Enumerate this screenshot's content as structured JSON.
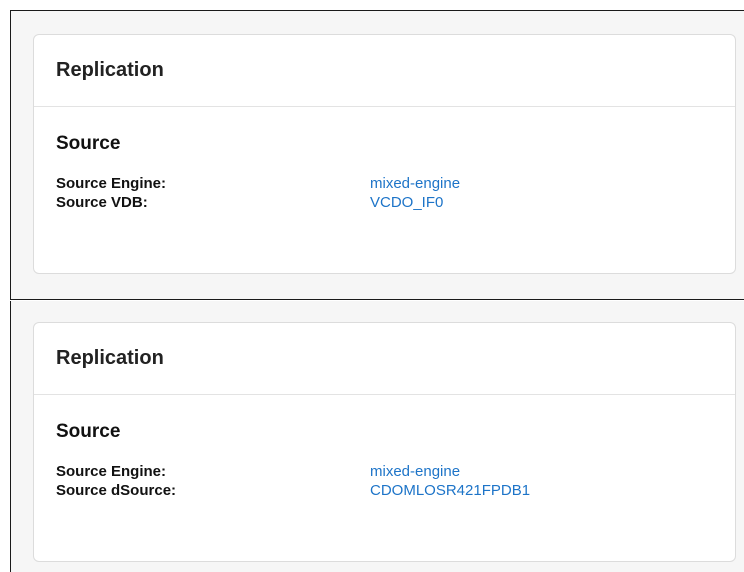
{
  "panels": [
    {
      "card_title": "Replication",
      "section_title": "Source",
      "fields": [
        {
          "label": "Source Engine:",
          "value": "mixed-engine"
        },
        {
          "label": "Source VDB:",
          "value": "VCDO_IF0"
        }
      ]
    },
    {
      "card_title": "Replication",
      "section_title": "Source",
      "fields": [
        {
          "label": "Source Engine:",
          "value": "mixed-engine"
        },
        {
          "label": "Source dSource:",
          "value": "CDOMLOSR421FPDB1"
        }
      ]
    }
  ],
  "colors": {
    "link": "#1d74c8",
    "panel_background": "#f6f6f6",
    "card_background": "#ffffff"
  }
}
